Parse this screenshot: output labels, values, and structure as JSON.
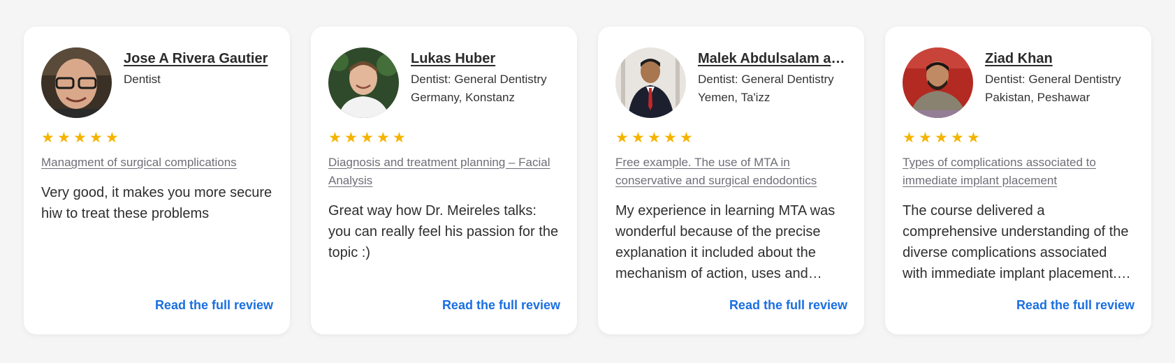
{
  "colors": {
    "star": "#f4b400",
    "link": "#1a6fe0",
    "course_link": "#6e6e78"
  },
  "reviews": [
    {
      "name": "Jose A Rivera Gautier",
      "meta_line1": "Dentist",
      "meta_line2": "",
      "rating": 5,
      "course": "Managment of surgical complications",
      "review": "Very good, it makes you more secure hiw to treat these problems",
      "read_more": "Read the full review"
    },
    {
      "name": "Lukas Huber",
      "meta_line1": "Dentist: General Dentistry",
      "meta_line2": "Germany, Konstanz",
      "rating": 5,
      "course": "Diagnosis and treatment planning – Facial Analysis",
      "review": "Great way how Dr. Meireles talks: you can really feel his passion for the topic :)",
      "read_more": "Read the full review"
    },
    {
      "name": "Malek Abdulsalam abdullah Almansoob",
      "meta_line1": "Dentist: General Dentistry",
      "meta_line2": "Yemen, Ta'izz",
      "rating": 5,
      "course": "Free example. The use of MTA in conservative and surgical endodontics",
      "review": "My experience in learning MTA was wonderful because of the precise explanation it included about the mechanism of action, uses and applications of the material.",
      "read_more": "Read the full review"
    },
    {
      "name": "Ziad Khan",
      "meta_line1": "Dentist: General Dentistry",
      "meta_line2": "Pakistan, Peshawar",
      "rating": 5,
      "course": "Types of complications associated to immediate implant placement",
      "review": "The course delivered a comprehensive understanding of the diverse complications associated with immediate implant placement. It was very helpful.",
      "read_more": "Read the full review"
    }
  ]
}
